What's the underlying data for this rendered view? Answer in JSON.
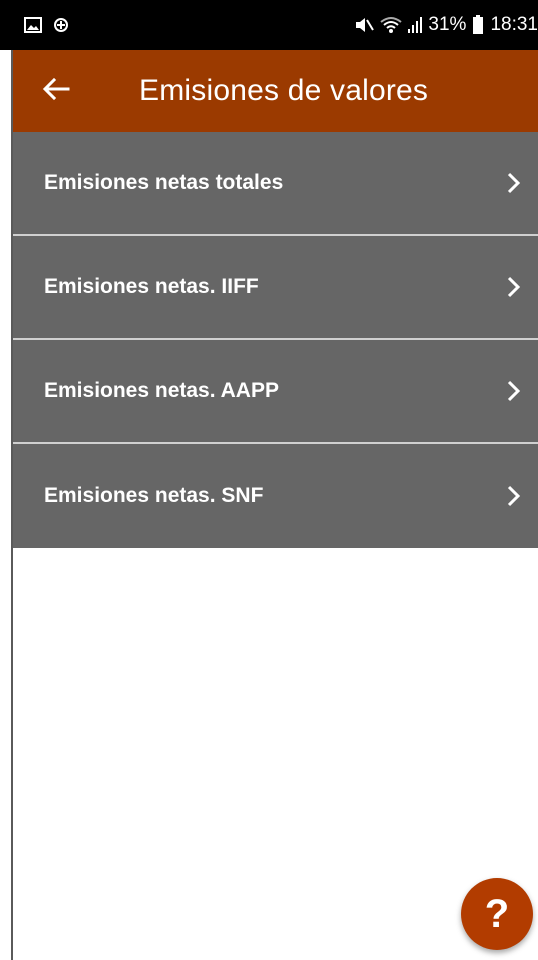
{
  "status_bar": {
    "battery_percent": "31%",
    "time": "18:31",
    "icons": [
      "gallery-icon",
      "data-saver-icon",
      "mute-icon",
      "wifi-icon",
      "signal-icon",
      "battery-icon"
    ]
  },
  "app_bar": {
    "back_icon": "arrow-left-icon",
    "title": "Emisiones de valores",
    "background_color": "#9b3a00"
  },
  "menu": {
    "items": [
      {
        "label": "Emisiones netas totales"
      },
      {
        "label": "Emisiones netas. IIFF"
      },
      {
        "label": "Emisiones netas. AAPP"
      },
      {
        "label": "Emisiones netas. SNF"
      }
    ],
    "item_background": "#666666",
    "chevron_icon": "chevron-right-icon"
  },
  "fab": {
    "label": "?",
    "color": "#b23c00"
  }
}
